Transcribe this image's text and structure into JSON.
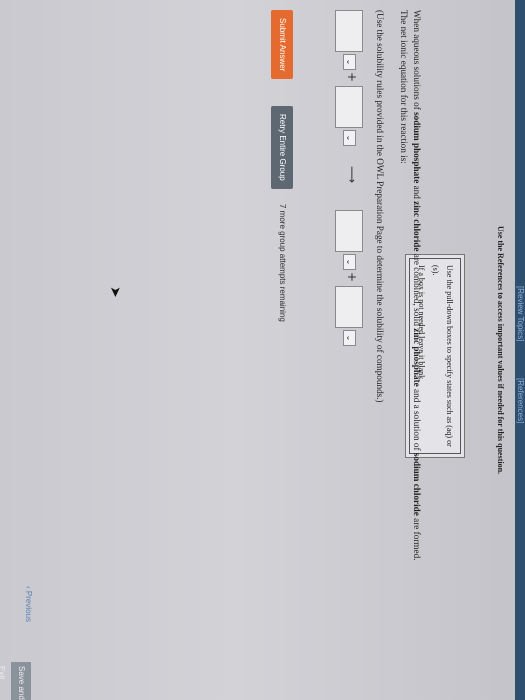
{
  "top_links": {
    "review": "[Review Topics]",
    "references": "[References]"
  },
  "references_note": "Use the References to access important values if needed for this question.",
  "hint": {
    "line1": "Use the pull-down boxes to specify states such as (aq) or (s).",
    "line2": "If a box is not needed leave it blank."
  },
  "question": {
    "t1": "When aqueous solutions of ",
    "b1": "sodium phosphate",
    "t2": " and ",
    "b2": "zinc chloride",
    "t3": " are combined, solid ",
    "b3": "zinc phosphate",
    "t4": " and a solution of ",
    "b4": "sodium chloride",
    "t5": " are formed.",
    "line2": "The net ionic equation for this reaction is:"
  },
  "solubility_note": "(Use the solubility rules provided in the OWL Preparation Page to determine the solubility of compounds.)",
  "equation": {
    "plus": "+",
    "arrow": "⟶",
    "select_glyph": "⌄"
  },
  "buttons": {
    "submit": "Submit Answer",
    "retry": "Retry Entire Group",
    "attempts": "7 more group attempts remaining"
  },
  "nav": {
    "previous": "Previous",
    "save_exit": "Save and Exit"
  },
  "colors": {
    "submit": "#e56a2f",
    "retry": "#5e6873",
    "topbar": "#2f4f6f"
  }
}
